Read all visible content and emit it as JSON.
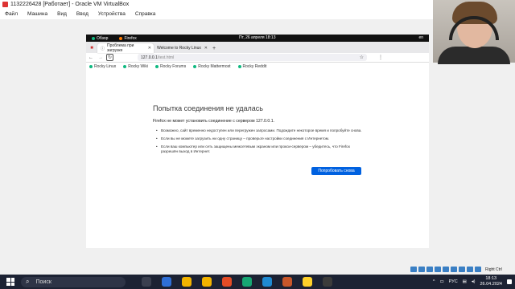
{
  "vbox": {
    "title": "1132226428 [Работает] - Oracle VM VirtualBox",
    "menu": [
      "Файл",
      "Машина",
      "Вид",
      "Ввод",
      "Устройства",
      "Справка"
    ],
    "status_host_key": "Right Ctrl"
  },
  "gnome": {
    "overview": "Обзор",
    "app": "Firefox",
    "clock": "Пт, 26 апреля  18:13",
    "lang": "en"
  },
  "firefox": {
    "tabs": [
      {
        "label": "Проблема при загрузке"
      },
      {
        "label": "Welcome to Rocky Linux"
      }
    ],
    "url_host": "127.0.0.1",
    "url_path": "/test.html",
    "bookmarks": [
      "Rocky Linux",
      "Rocky Wiki",
      "Rocky Forums",
      "Rocky Mattermost",
      "Rocky Reddit"
    ]
  },
  "error_page": {
    "title": "Попытка соединения не удалась",
    "description": "Firefox не может установить соединение с сервером 127.0.0.1.",
    "bullets": [
      "Возможно, сайт временно недоступен или перегружен запросами. Подождите некоторое время и попробуйте снова.",
      "Если вы не можете загрузить ни одну страницу – проверьте настройки соединения с Интернетом.",
      "Если ваш компьютер или сеть защищены межсетевым экраном или прокси-сервером – убедитесь, что Firefox разрешён выход в Интернет."
    ],
    "retry_label": "Попробовать снова"
  },
  "taskbar": {
    "search_placeholder": "Поиск",
    "lang": "РУС",
    "time": "18:13",
    "date": "26.04.2024",
    "icon_colors": [
      "#3a3f4f",
      "#2f6fd6",
      "#f2b300",
      "#f2b300",
      "#e34c26",
      "#17a673",
      "#1f8ad1",
      "#c8572a",
      "#ffd12a",
      "#3b3b3b"
    ]
  }
}
